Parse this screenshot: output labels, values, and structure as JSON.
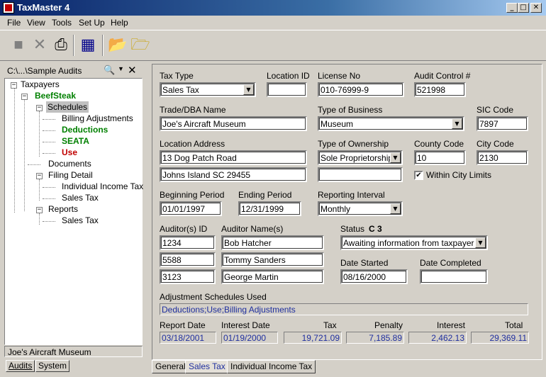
{
  "window": {
    "title": "TaxMaster 4",
    "min": "_",
    "max": "□",
    "close": "✕"
  },
  "menu": [
    "File",
    "View",
    "Tools",
    "Set Up",
    "Help"
  ],
  "sidebar": {
    "path": "C:\\...\\Sample Audits",
    "tree": {
      "taxpayers": "Taxpayers",
      "beefsteak": "BeefSteak",
      "schedules": "Schedules",
      "billing": "Billing Adjustments",
      "deductions": "Deductions",
      "seata": "SEATA",
      "use": "Use",
      "documents": "Documents",
      "filing": "Filing Detail",
      "individual": "Individual Income Tax",
      "sales1": "Sales Tax",
      "reports": "Reports",
      "sales2": "Sales Tax"
    },
    "status": "Joe's Aircraft Museum",
    "tabs": [
      "Audits",
      "System"
    ]
  },
  "form": {
    "tax_type": {
      "label": "Tax Type",
      "value": "Sales Tax"
    },
    "location_id": {
      "label": "Location ID",
      "value": ""
    },
    "license_no": {
      "label": "License No",
      "value": "010-76999-9"
    },
    "audit_control": {
      "label": "Audit Control #",
      "value": "521998"
    },
    "trade_name": {
      "label": "Trade/DBA Name",
      "value": "Joe's Aircraft Museum"
    },
    "business_type": {
      "label": "Type of Business",
      "value": "Museum"
    },
    "sic_code": {
      "label": "SIC Code",
      "value": "7897"
    },
    "location_address": {
      "label": "Location Address",
      "line1": "13 Dog Patch Road",
      "line2": "Johns Island SC  29455"
    },
    "ownership": {
      "label": "Type of Ownership",
      "value": "Sole Proprietorship",
      "extra": ""
    },
    "county_code": {
      "label": "County Code",
      "value": "10"
    },
    "city_code": {
      "label": "City Code",
      "value": "2130"
    },
    "city_limits": {
      "label": "Within City Limits",
      "checked": "✔"
    },
    "beginning_period": {
      "label": "Beginning Period",
      "value": "01/01/1997"
    },
    "ending_period": {
      "label": "Ending Period",
      "value": "12/31/1999"
    },
    "reporting_interval": {
      "label": "Reporting Interval",
      "value": "Monthly"
    },
    "auditor_ids": {
      "label": "Auditor(s) ID",
      "values": [
        "1234",
        "5588",
        "3123"
      ]
    },
    "auditor_names": {
      "label": "Auditor Name(s)",
      "values": [
        "Bob Hatcher",
        "Tommy Sanders",
        "George Martin"
      ]
    },
    "status": {
      "label": "Status",
      "code": "C 3",
      "value": "Awaiting information from taxpayer"
    },
    "date_started": {
      "label": "Date Started",
      "value": "08/16/2000"
    },
    "date_completed": {
      "label": "Date Completed",
      "value": ""
    },
    "adjustments": {
      "label": "Adjustment Schedules Used",
      "value": "Deductions;Use;Billing Adjustments"
    },
    "summary": {
      "report_date": {
        "label": "Report Date",
        "value": "03/18/2001"
      },
      "interest_date": {
        "label": "Interest Date",
        "value": "01/19/2000"
      },
      "tax": {
        "label": "Tax",
        "value": "19,721.09"
      },
      "penalty": {
        "label": "Penalty",
        "value": "7,185.89"
      },
      "interest": {
        "label": "Interest",
        "value": "2,462.13"
      },
      "total": {
        "label": "Total",
        "value": "29,369.11"
      }
    }
  },
  "bottom_tabs": [
    "General",
    "Sales Tax",
    "Individual Income Tax"
  ]
}
